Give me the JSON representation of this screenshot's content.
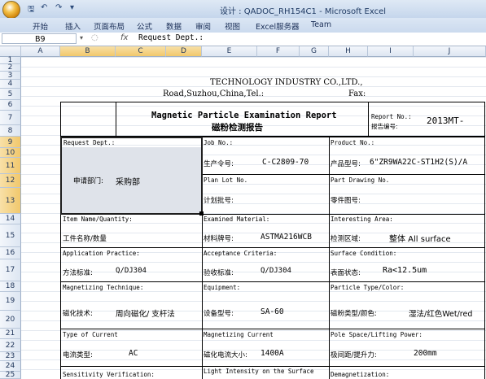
{
  "window": {
    "title": "设计 : QADOC_RH154C1 - Microsoft Excel"
  },
  "ribbon": {
    "tabs": [
      "开始",
      "插入",
      "页面布局",
      "公式",
      "数据",
      "审阅",
      "视图",
      "Excel服务器",
      "Team"
    ]
  },
  "formula_bar": {
    "cell": "B9",
    "fx": "fx",
    "content": "Request Dept.:"
  },
  "columns": [
    "A",
    "B",
    "C",
    "D",
    "E",
    "F",
    "G",
    "H",
    "I",
    "J"
  ],
  "rows": [
    "1",
    "2",
    "3",
    "4",
    "5",
    "6",
    "7",
    "8",
    "9",
    "10",
    "11",
    "12",
    "13",
    "14",
    "15",
    "16",
    "17",
    "18",
    "19",
    "20",
    "21",
    "22",
    "23",
    "24",
    "25"
  ],
  "sheet": {
    "company": "TECHNOLOGY INDUSTRY CO.,LTD.,",
    "address": "Road,Suzhou,China,Tel.:",
    "fax": "Fax:",
    "report_title_en": "Magnetic Particle Examination Report",
    "report_title_cn": "磁粉检测报告",
    "report_no_en": "Report No.:",
    "report_no_cn": "报告编号:",
    "report_no_value": "2013MT-",
    "request_dept_en": "Request Dept.:",
    "request_dept_cn": "申请部门:",
    "request_dept_value": "采购部",
    "job_no_en": "Job No.:",
    "job_no_cn": "生产令号:",
    "job_no_value": "C-C2809-70",
    "product_no_en": "Product No.:",
    "product_no_cn": "产品型号:",
    "product_no_value": "6\"ZR9WA22C-ST1H2(S)/A",
    "plan_lot_en": "Plan Lot No.",
    "plan_lot_cn": "计划批号:",
    "part_drawing_en": "Part Drawing No.",
    "part_drawing_cn": "零件图号:",
    "item_name_en": "Item Name/Quantity:",
    "item_name_cn": "工件名称/数量",
    "material_en": "Examined Material:",
    "material_cn": "材料牌号:",
    "material_value": "ASTMA216WCB",
    "area_en": "Interesting Area:",
    "area_cn": "检测区域:",
    "area_value": "整体 All surface",
    "practice_en": "Application Practice:",
    "practice_cn": "方法标准:",
    "practice_value": "Q/DJ304",
    "acceptance_en": "Acceptance Criteria:",
    "acceptance_cn": "验收标准:",
    "acceptance_value": "Q/DJ304",
    "surface_en": "Surface Condition:",
    "surface_cn": "表面状态:",
    "surface_value": "Ra<12.5um",
    "technique_en": "Magnetizing Technique:",
    "technique_cn": "磁化技术:",
    "technique_value": "周向磁化/ 支杆法",
    "equipment_en": "Equipment:",
    "equipment_cn": "设备型号:",
    "equipment_value": "SA-60",
    "particle_en": "Particle Type/Color:",
    "particle_cn": "磁粉类型/颜色:",
    "particle_value": "湿法/红色Wet/red",
    "current_type_en": "Type of Current",
    "current_type_cn": "电流类型:",
    "current_type_value": "AC",
    "mag_current_en": "Magnetizing Current",
    "mag_current_cn": "磁化电流大小:",
    "mag_current_value": "1400A",
    "pole_space_en": "Pole Space/Lifting Power:",
    "pole_space_cn": "极间距/提升力:",
    "pole_space_value": "200mm",
    "sensitivity_en": "Sensitivity Verification:",
    "light_en": "Light Intensity on the Surface",
    "demag_en": "Demagnetization:"
  }
}
